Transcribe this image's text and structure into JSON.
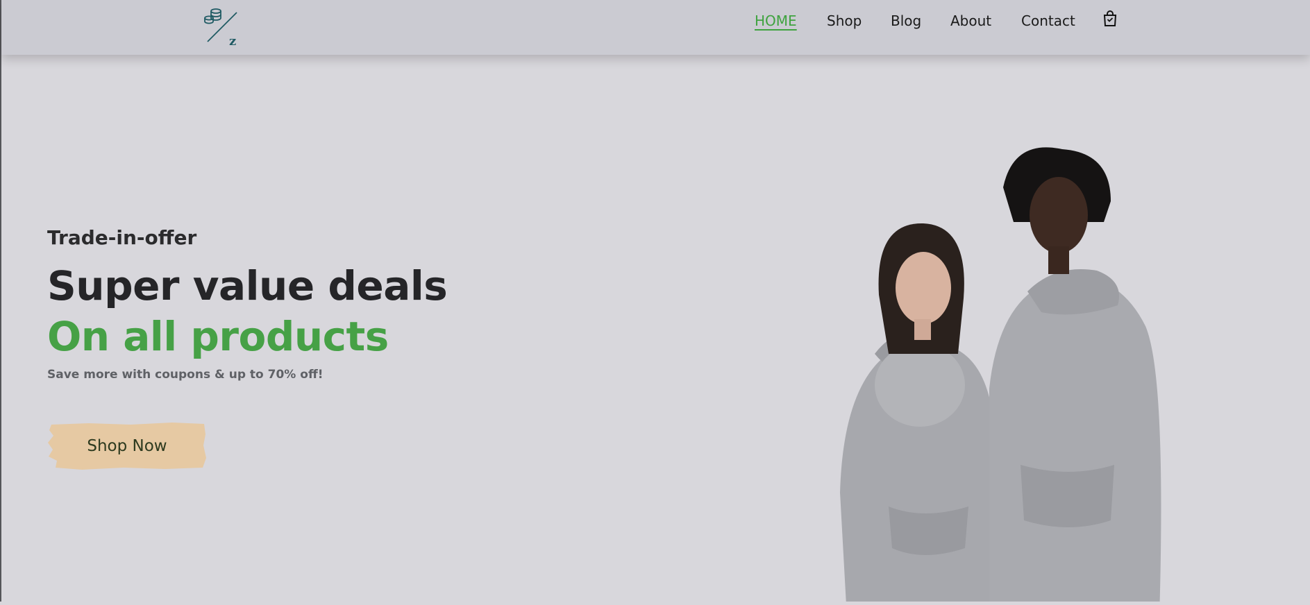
{
  "header": {
    "logo_icon": "coins-slash-z-logo",
    "logo_letter": "z",
    "nav": [
      {
        "label": "HOME",
        "active": true
      },
      {
        "label": "Shop",
        "active": false
      },
      {
        "label": "Blog",
        "active": false
      },
      {
        "label": "About",
        "active": false
      },
      {
        "label": "Contact",
        "active": false
      }
    ],
    "cart_icon": "shopping-bag-icon"
  },
  "hero": {
    "eyebrow": "Trade-in-offer",
    "headline": "Super value deals",
    "headline_green": "On all products",
    "subtext": "Save more with coupons & up to 70% off!",
    "cta_label": "Shop Now",
    "image": "two-models-grey-hoodies"
  },
  "colors": {
    "page_bg": "#d8d7dc",
    "header_bg": "#cbcbd2",
    "accent_green": "#46a146",
    "cta_bg": "#e6c9a3",
    "logo_color": "#1f5a63"
  }
}
